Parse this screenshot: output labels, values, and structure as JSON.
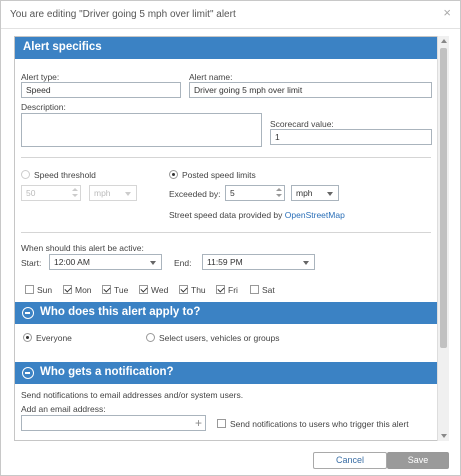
{
  "dialog": {
    "title": "You are editing \"Driver going 5 mph over limit\" alert",
    "close_symbol": "×"
  },
  "specifics": {
    "header": "Alert specifics",
    "alert_type_label": "Alert type:",
    "alert_type_value": "Speed",
    "alert_name_label": "Alert name:",
    "alert_name_value": "Driver going 5 mph over limit",
    "description_label": "Description:",
    "scorecard_label": "Scorecard value:",
    "scorecard_value": "1",
    "speed_threshold_label": "Speed threshold",
    "speed_threshold_value": "50",
    "speed_threshold_unit": "mph",
    "posted_limits_label": "Posted speed limits",
    "exceeded_by_label": "Exceeded by:",
    "exceeded_by_value": "5",
    "exceeded_by_unit": "mph",
    "street_data_text": "Street speed data provided by",
    "street_data_link": "OpenStreetMap",
    "active_label": "When should this alert be active:",
    "start_label": "Start:",
    "start_value": "12:00 AM",
    "end_label": "End:",
    "end_value": "11:59 PM",
    "days": [
      {
        "label": "Sun",
        "checked": false
      },
      {
        "label": "Mon",
        "checked": true
      },
      {
        "label": "Tue",
        "checked": true
      },
      {
        "label": "Wed",
        "checked": true
      },
      {
        "label": "Thu",
        "checked": true
      },
      {
        "label": "Fri",
        "checked": true
      },
      {
        "label": "Sat",
        "checked": false
      }
    ]
  },
  "applies": {
    "header": "Who does this alert apply to?",
    "everyone_label": "Everyone",
    "select_label": "Select users, vehicles or groups"
  },
  "notify": {
    "header": "Who gets a notification?",
    "intro_text": "Send notifications to email addresses and/or system users.",
    "email_label": "Add an email address:",
    "email_placeholder": "",
    "trigger_label": "Send notifications to users who trigger this alert"
  },
  "footer": {
    "cancel_label": "Cancel",
    "save_label": "Save"
  }
}
